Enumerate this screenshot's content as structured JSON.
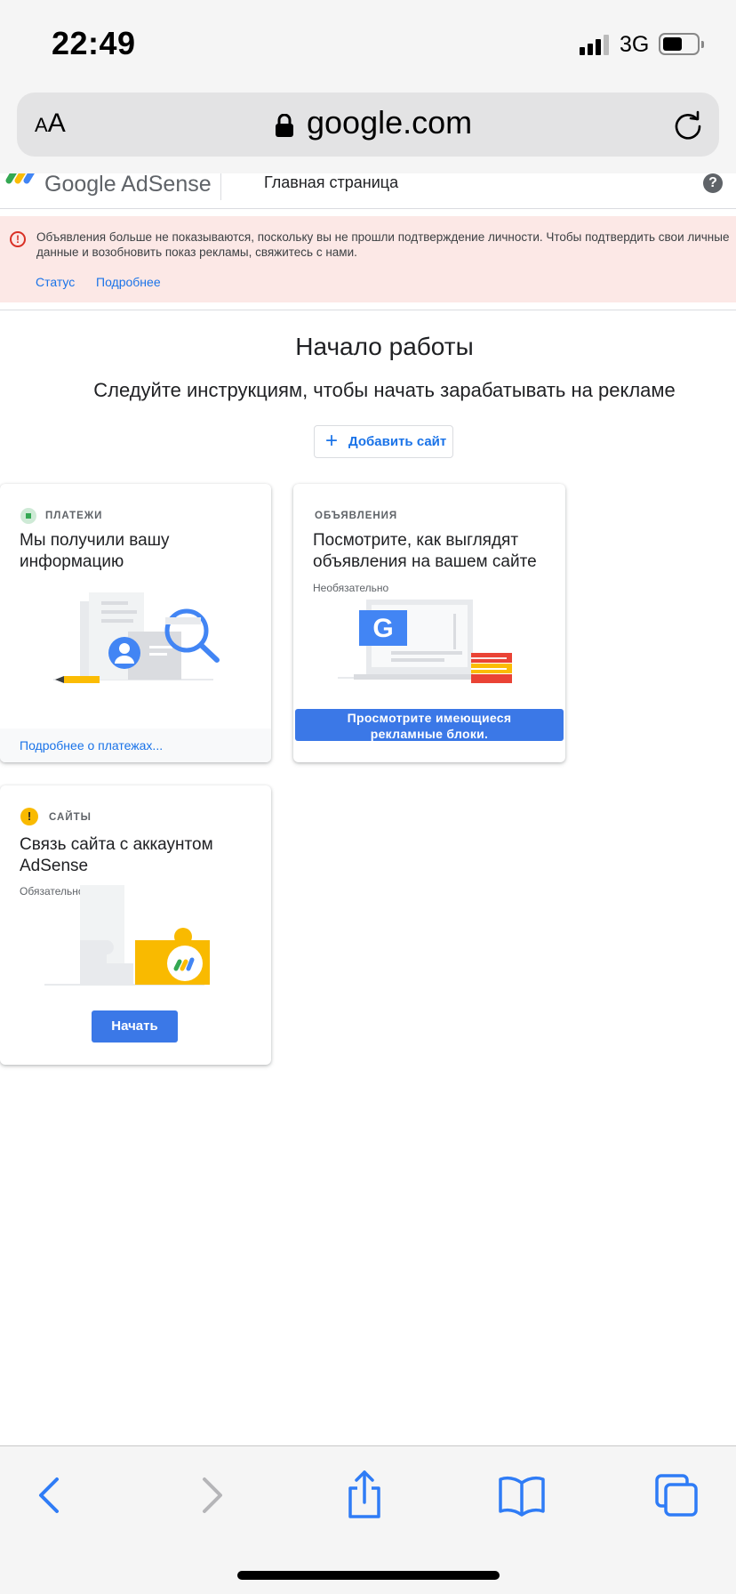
{
  "status_bar": {
    "time": "22:49",
    "network": "3G"
  },
  "address_bar": {
    "text_size_label": "AA",
    "url": "google.com"
  },
  "header": {
    "brand": "Google AdSense",
    "page_title": "Главная страница",
    "help_label": "?"
  },
  "alert": {
    "message": "Объявления больше не показываются, поскольку вы не прошли подтверждение личности. Чтобы подтвердить свои личные данные и возобновить показ рекламы, свяжитесь с нами.",
    "links": [
      "Статус",
      "Подробнее"
    ],
    "icon": "error-icon"
  },
  "main": {
    "title": "Начало работы",
    "subtitle": "Следуйте инструкциям, чтобы начать зарабатывать на рекламе",
    "add_site_label": "Добавить сайт"
  },
  "cards": [
    {
      "kicker": "ПЛАТЕЖИ",
      "title": "Мы получили вашу информацию",
      "link": "Подробнее о платежах...",
      "status_color": "#34a853"
    },
    {
      "kicker": "ОБЪЯВЛЕНИЯ",
      "title": "Посмотрите, как выглядят объявления на вашем сайте",
      "requirement": "Необязательно",
      "button": "Просмотрите имеющиеся рекламные блоки."
    },
    {
      "kicker": "САЙТЫ",
      "title": "Связь сайта с аккаунтом AdSense",
      "requirement": "Обязательно",
      "button": "Начать",
      "status_color": "#f9ba00",
      "status_icon_label": "!"
    }
  ],
  "colors": {
    "accent": "#1a73e8",
    "button": "#3b78e7",
    "alert_bg": "#fce8e6",
    "alert_icon": "#d93025"
  },
  "toolbar": {
    "icons": [
      "back-icon",
      "forward-icon",
      "share-icon",
      "bookmarks-icon",
      "tabs-icon"
    ]
  }
}
